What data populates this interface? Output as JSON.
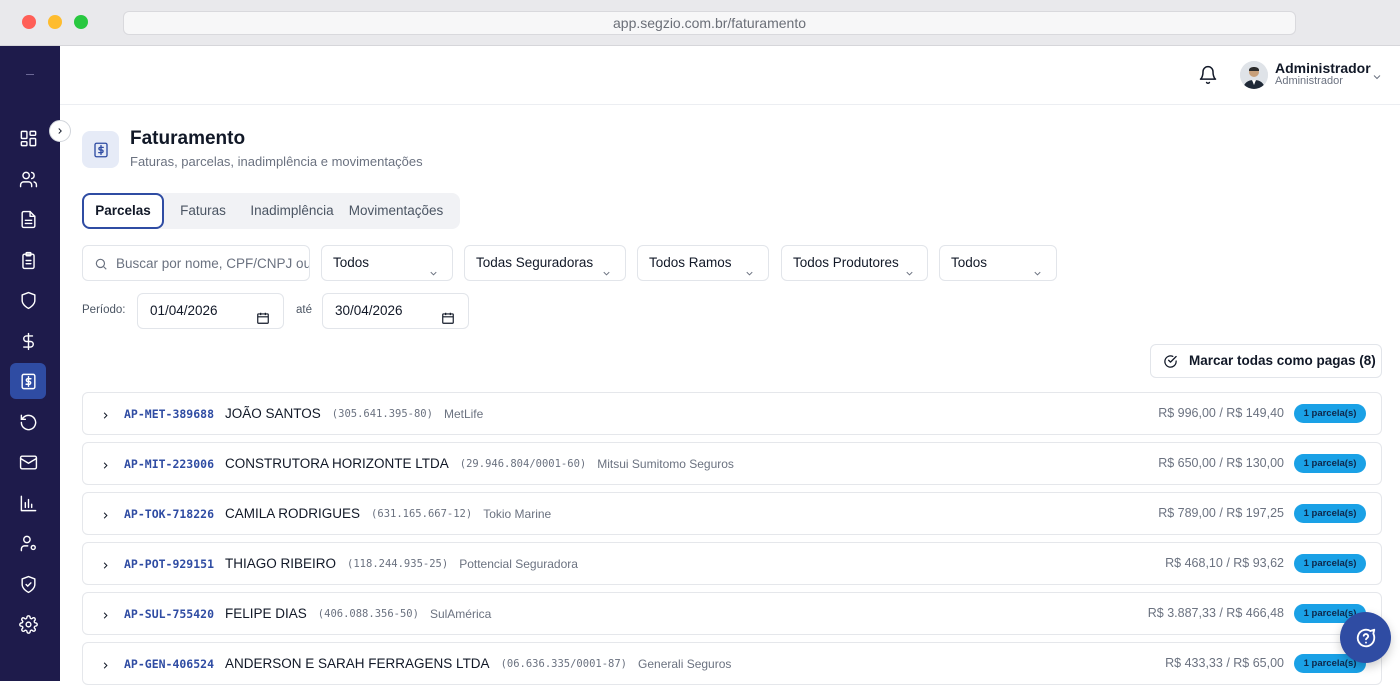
{
  "browser": {
    "url": "app.segzio.com.br/faturamento"
  },
  "sidebar": {
    "items": [
      {
        "name": "dashboard",
        "icon": "grid-icon"
      },
      {
        "name": "clientes",
        "icon": "users-icon"
      },
      {
        "name": "documentos",
        "icon": "file-text-icon"
      },
      {
        "name": "propostas",
        "icon": "clipboard-icon"
      },
      {
        "name": "apolices",
        "icon": "shield-icon"
      },
      {
        "name": "financeiro",
        "icon": "dollar-icon"
      },
      {
        "name": "faturamento",
        "icon": "invoice-dollar-icon",
        "active": true
      },
      {
        "name": "renovacoes",
        "icon": "refresh-icon"
      },
      {
        "name": "mensagens",
        "icon": "mail-icon"
      },
      {
        "name": "relatorios",
        "icon": "bar-chart-icon"
      },
      {
        "name": "usuarios",
        "icon": "user-cog-icon"
      },
      {
        "name": "seguranca",
        "icon": "shield-check-icon"
      },
      {
        "name": "configuracoes",
        "icon": "gear-icon"
      }
    ]
  },
  "header": {
    "user_name": "Administrador",
    "user_role": "Administrador"
  },
  "page": {
    "title": "Faturamento",
    "subtitle": "Faturas, parcelas, inadimplência e movimentações"
  },
  "tabs": [
    {
      "label": "Parcelas",
      "active": true
    },
    {
      "label": "Faturas"
    },
    {
      "label": "Inadimplência"
    },
    {
      "label": "Movimentações"
    }
  ],
  "filters": {
    "search_placeholder": "Buscar por nome, CPF/CNPJ ou código",
    "status": "Todos",
    "seguradoras": "Todas Seguradoras",
    "ramos": "Todos Ramos",
    "produtores": "Todos Produtores",
    "outros": "Todos",
    "periodo_label": "Período:",
    "ate_label": "até",
    "date_from": "01/04/2026",
    "date_to": "30/04/2026"
  },
  "actions": {
    "mark_all": "Marcar todas como pagas (8)"
  },
  "rows": [
    {
      "code": "AP-MET-389688",
      "name": "JOÃO SANTOS",
      "doc": "(305.641.395-80)",
      "insurer": "MetLife",
      "amount": "R$ 996,00 / R$ 149,40",
      "badge": "1 parcela(s)"
    },
    {
      "code": "AP-MIT-223006",
      "name": "CONSTRUTORA HORIZONTE LTDA",
      "doc": "(29.946.804/0001-60)",
      "insurer": "Mitsui Sumitomo Seguros",
      "amount": "R$ 650,00 / R$ 130,00",
      "badge": "1 parcela(s)"
    },
    {
      "code": "AP-TOK-718226",
      "name": "CAMILA RODRIGUES",
      "doc": "(631.165.667-12)",
      "insurer": "Tokio Marine",
      "amount": "R$ 789,00 / R$ 197,25",
      "badge": "1 parcela(s)"
    },
    {
      "code": "AP-POT-929151",
      "name": "THIAGO RIBEIRO",
      "doc": "(118.244.935-25)",
      "insurer": "Pottencial Seguradora",
      "amount": "R$ 468,10 / R$ 93,62",
      "badge": "1 parcela(s)"
    },
    {
      "code": "AP-SUL-755420",
      "name": "FELIPE DIAS",
      "doc": "(406.088.356-50)",
      "insurer": "SulAmérica",
      "amount": "R$ 3.887,33 / R$ 466,48",
      "badge": "1 parcela(s)"
    },
    {
      "code": "AP-GEN-406524",
      "name": "ANDERSON E SARAH FERRAGENS LTDA",
      "doc": "(06.636.335/0001-87)",
      "insurer": "Generali Seguros",
      "amount": "R$ 433,33 / R$ 65,00",
      "badge": "1 parcela(s)"
    }
  ],
  "colors": {
    "sidebar_bg": "#1e1b4b",
    "accent": "#2f4ca3",
    "badge": "#1aa1e6"
  }
}
